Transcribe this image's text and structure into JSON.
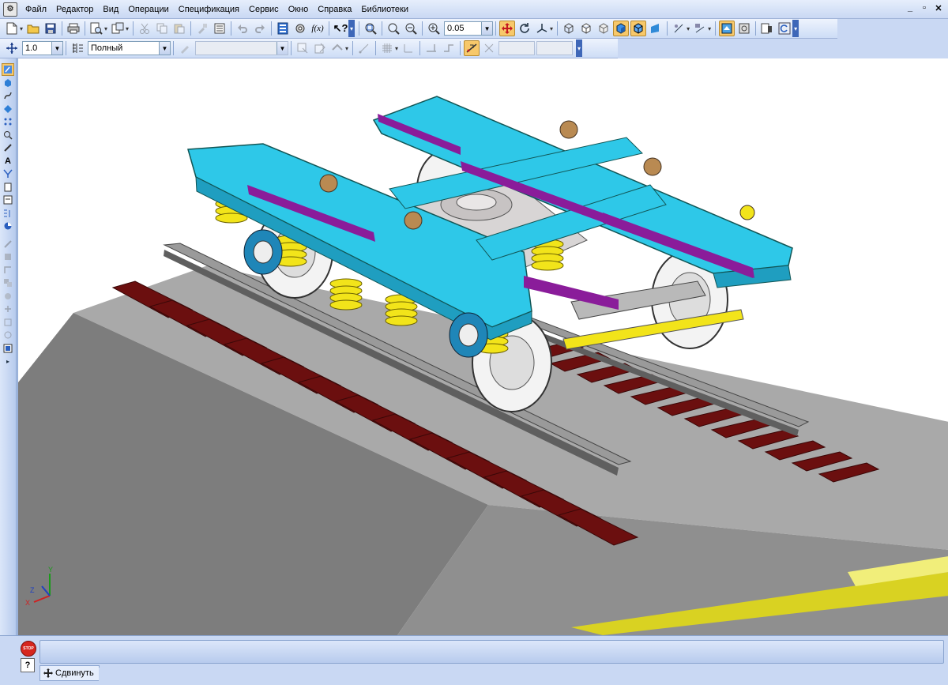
{
  "menu": {
    "items": [
      "Файл",
      "Редактор",
      "Вид",
      "Операции",
      "Спецификация",
      "Сервис",
      "Окно",
      "Справка",
      "Библиотеки"
    ]
  },
  "window_controls": [
    "_",
    "▫",
    "✕"
  ],
  "toolbar1": {
    "zoom_value": "0.05"
  },
  "toolbar2": {
    "step_value": "1.0",
    "display_mode": "Полный"
  },
  "viewport": {
    "background": "#ffffff",
    "axes": {
      "x": "X",
      "y": "Y",
      "z": "Z"
    },
    "colors": {
      "frame": "#2ec8e8",
      "springs": "#f2e41a",
      "beams": "#8a1c9a",
      "sleepers": "#6b0f0f",
      "ballast": "#8c8c8c",
      "rail": "#7a7a7a",
      "embankment_edge": "#d9d222"
    }
  },
  "bottom": {
    "stop_label": "STOP",
    "help_label": "?",
    "status_command": "Сдвинуть"
  }
}
